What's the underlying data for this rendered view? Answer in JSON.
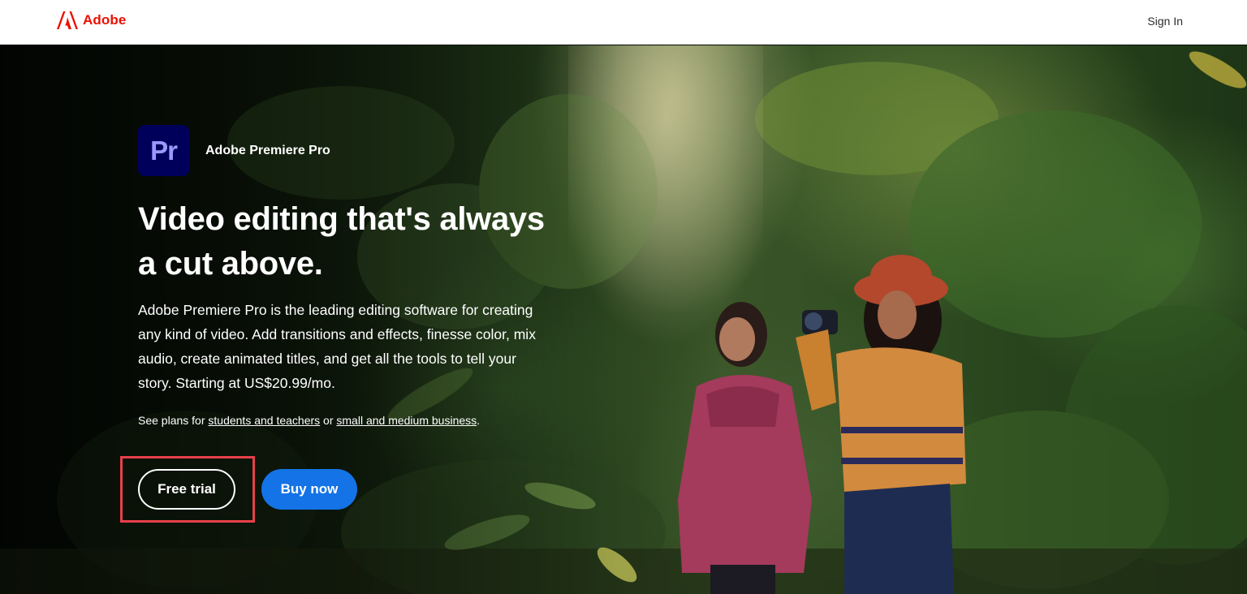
{
  "header": {
    "brand_name": "Adobe",
    "sign_in_label": "Sign In",
    "brand_color": "#eb1000"
  },
  "hero": {
    "product_icon_text": "Pr",
    "product_name": "Adobe Premiere Pro",
    "headline_line1": "Video editing that's always",
    "headline_line2": "a cut above.",
    "description": "Adobe Premiere Pro is the leading editing software for creating any kind of video. Add transitions and effects, finesse color, mix audio, create animated titles, and get all the tools to tell your story. Starting at US$20.99/mo.",
    "plans_prefix": "See plans for ",
    "plans_link_students": "students and teachers",
    "plans_middle": " or ",
    "plans_link_business": "small and medium business",
    "plans_suffix": ".",
    "free_trial_label": "Free trial",
    "buy_now_label": "Buy now",
    "accent_color": "#1473e6",
    "highlight_color": "#e8404a"
  }
}
